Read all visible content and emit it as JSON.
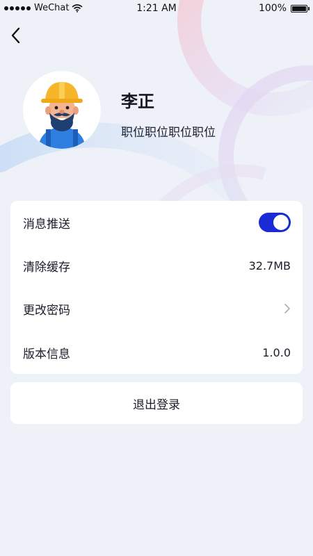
{
  "status_bar": {
    "carrier": "WeChat",
    "time": "1:21 AM",
    "battery": "100%"
  },
  "header": {
    "back_icon": "chevron-left-icon"
  },
  "profile": {
    "name": "李正",
    "position": "职位职位职位职位",
    "avatar_icon": "worker-avatar"
  },
  "settings": {
    "items": [
      {
        "label": "消息推送",
        "control": "toggle",
        "enabled": true
      },
      {
        "label": "清除缓存",
        "value": "32.7MB"
      },
      {
        "label": "更改密码",
        "control": "chevron-right-icon"
      },
      {
        "label": "版本信息",
        "value": "1.0.0"
      }
    ]
  },
  "logout": {
    "label": "退出登录"
  },
  "colors": {
    "accent": "#1a2bd6",
    "background": "#eef1f8",
    "card": "#ffffff",
    "text": "#1b1d2a"
  }
}
